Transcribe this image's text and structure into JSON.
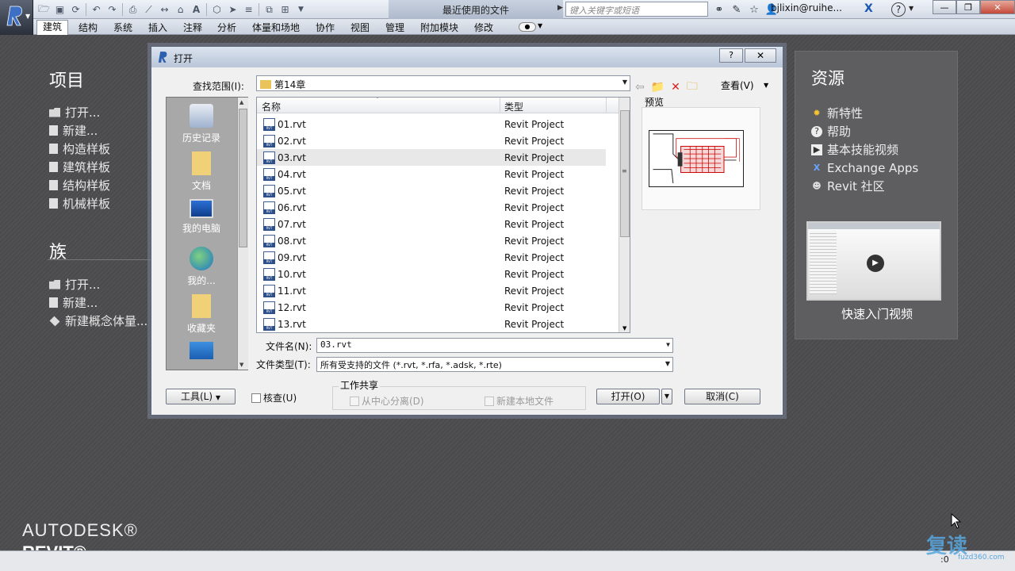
{
  "titlebar": {
    "document_title": "最近使用的文件",
    "search_placeholder": "键入关键字或短语",
    "user": "bjlixin@ruihe...",
    "help_symbol": "?",
    "minimize": "—",
    "restore": "❐",
    "close": "✕"
  },
  "ribbon": {
    "tabs": [
      "建筑",
      "结构",
      "系统",
      "插入",
      "注释",
      "分析",
      "体量和场地",
      "协作",
      "视图",
      "管理",
      "附加模块",
      "修改"
    ],
    "active_tab": "建筑"
  },
  "startpage": {
    "projects": {
      "heading": "项目",
      "items": [
        "打开...",
        "新建...",
        "构造样板",
        "建筑样板",
        "结构样板",
        "机械样板"
      ]
    },
    "families": {
      "heading": "族",
      "items": [
        "打开...",
        "新建...",
        "新建概念体量..."
      ]
    },
    "brand_line1": "AUTODESK®",
    "brand_line2": "REVIT®",
    "resources": {
      "heading": "资源",
      "items": [
        {
          "label": "新特性",
          "icon": "star-icon"
        },
        {
          "label": "帮助",
          "icon": "help-icon"
        },
        {
          "label": "基本技能视频",
          "icon": "video-icon"
        },
        {
          "label": "Exchange Apps",
          "icon": "exchange-icon"
        },
        {
          "label": "Revit 社区",
          "icon": "community-icon"
        }
      ],
      "video_label": "快速入门视频"
    }
  },
  "dialog": {
    "title": "打开",
    "help_button": "?",
    "close_button": "✕",
    "look_in_label": "查找范围(I):",
    "look_in_value": "第14章",
    "view_label": "查看(V)",
    "places": [
      "历史记录",
      "文档",
      "我的电脑",
      "我的...",
      "收藏夹"
    ],
    "columns": {
      "name": "名称",
      "type": "类型"
    },
    "files": [
      {
        "name": "01.rvt",
        "type": "Revit Project"
      },
      {
        "name": "02.rvt",
        "type": "Revit Project"
      },
      {
        "name": "03.rvt",
        "type": "Revit Project"
      },
      {
        "name": "04.rvt",
        "type": "Revit Project"
      },
      {
        "name": "05.rvt",
        "type": "Revit Project"
      },
      {
        "name": "06.rvt",
        "type": "Revit Project"
      },
      {
        "name": "07.rvt",
        "type": "Revit Project"
      },
      {
        "name": "08.rvt",
        "type": "Revit Project"
      },
      {
        "name": "09.rvt",
        "type": "Revit Project"
      },
      {
        "name": "10.rvt",
        "type": "Revit Project"
      },
      {
        "name": "11.rvt",
        "type": "Revit Project"
      },
      {
        "name": "12.rvt",
        "type": "Revit Project"
      },
      {
        "name": "13.rvt",
        "type": "Revit Project"
      }
    ],
    "selected_file": "03.rvt",
    "preview_label": "预览",
    "filename_label": "文件名(N):",
    "filename_value": "03.rvt",
    "filetype_label": "文件类型(T):",
    "filetype_value": "所有受支持的文件 (*.rvt, *.rfa, *.adsk, *.rte)",
    "worksharing_title": "工作共享",
    "detach_label": "从中心分离(D)",
    "new_local_label": "新建本地文件",
    "audit_label": "核查(U)",
    "tools_button": "工具(L)",
    "open_button": "打开(O)",
    "cancel_button": "取消(C)"
  },
  "statusbar": {
    "filter_count": ":0"
  },
  "watermark": {
    "text": "复读",
    "sub": "fuzd360.com"
  }
}
